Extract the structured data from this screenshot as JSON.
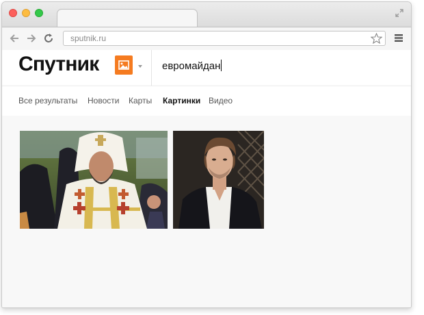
{
  "browser": {
    "url": "sputnik.ru"
  },
  "header": {
    "logo_text": "Спутник",
    "search_query": "евромайдан",
    "vertical_icon": "image-icon"
  },
  "tabs": [
    {
      "label": "Все результаты",
      "active": false
    },
    {
      "label": "Новости",
      "active": false
    },
    {
      "label": "Карты",
      "active": false
    },
    {
      "label": "Картинки",
      "active": true
    },
    {
      "label": "Видео",
      "active": false
    }
  ],
  "results": {
    "images": [
      {
        "subject": "clergyman-in-white-vestments"
      },
      {
        "subject": "young-man-in-dark-jacket"
      }
    ]
  },
  "colors": {
    "accent": "#f57b20",
    "close": "#fc605c",
    "minimize": "#fdbc40",
    "maximize": "#34c84a"
  }
}
